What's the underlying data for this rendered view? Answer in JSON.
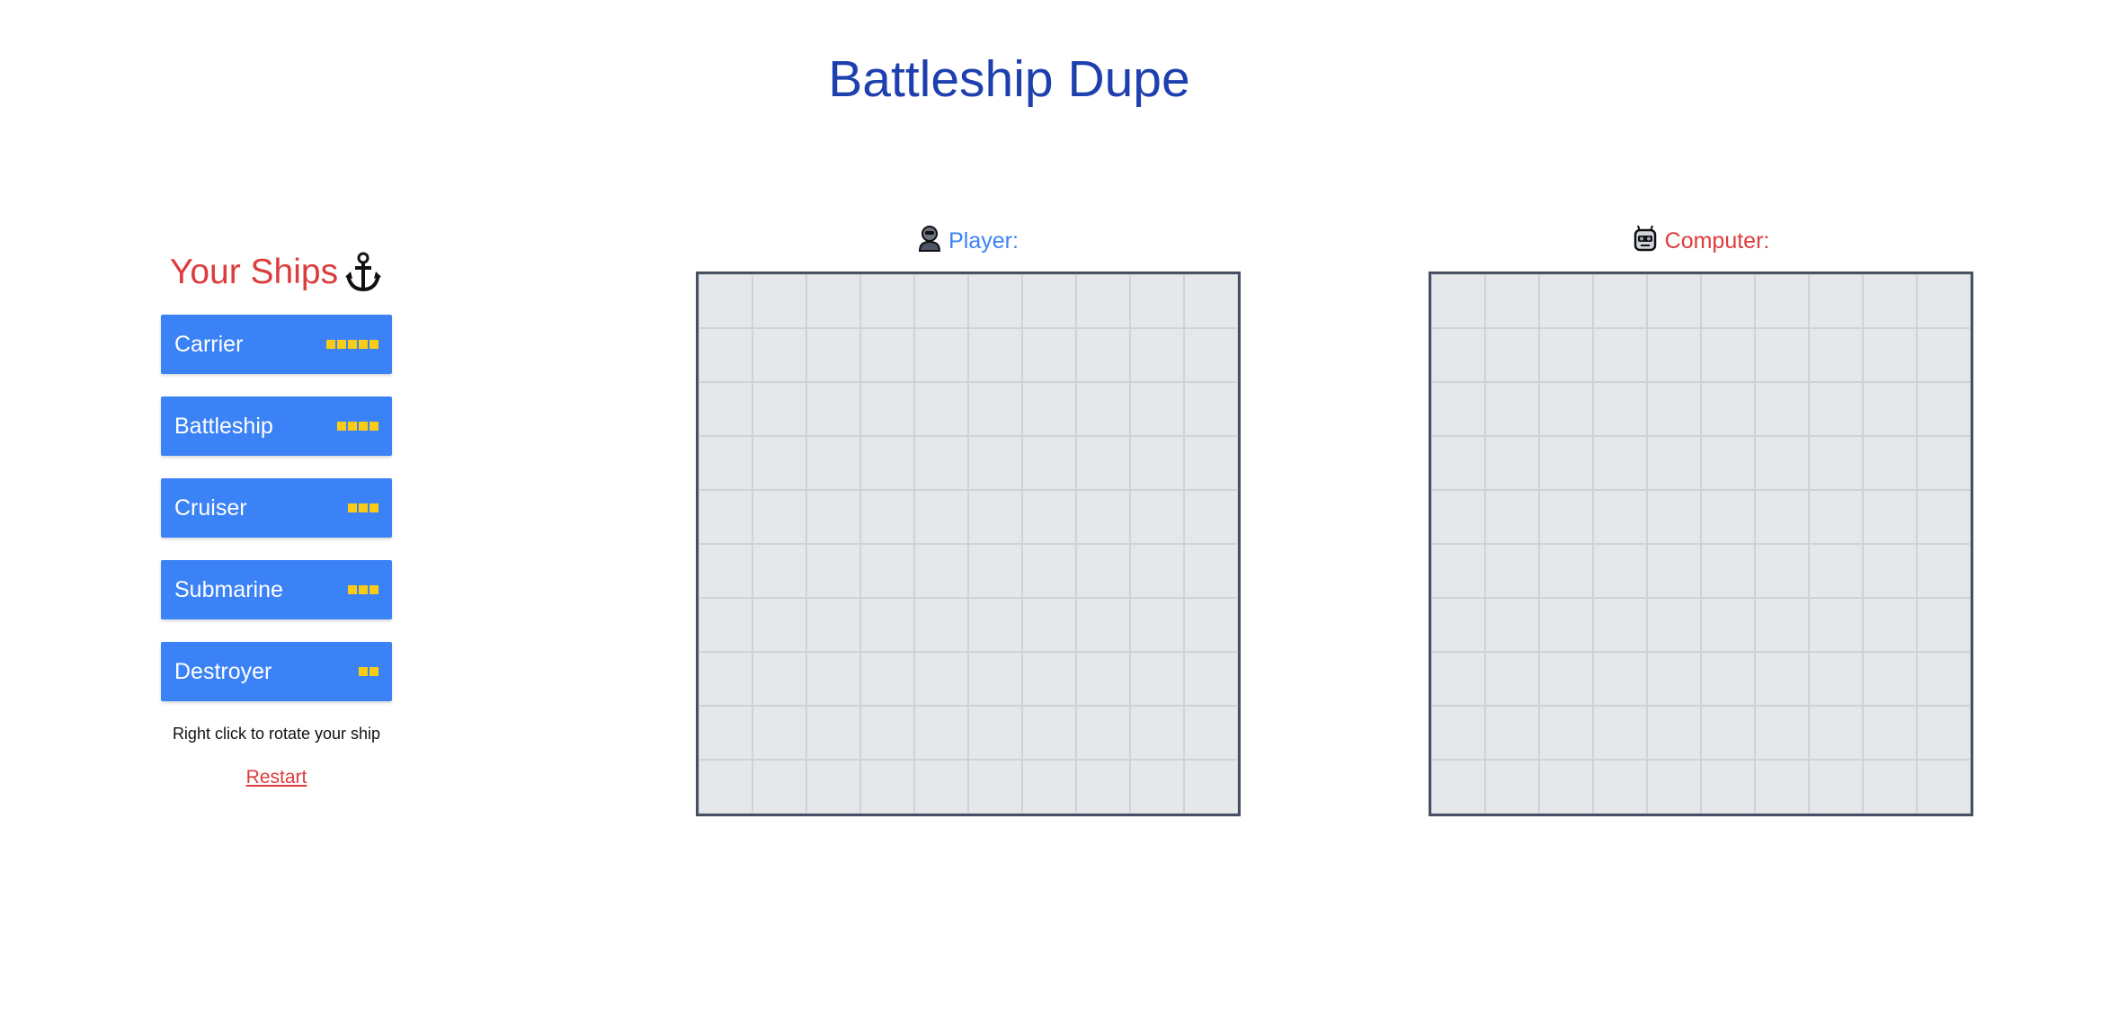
{
  "page": {
    "title": "Battleship Dupe"
  },
  "ships_panel": {
    "heading": "Your Ships",
    "ships": [
      {
        "name": "Carrier",
        "size": 5
      },
      {
        "name": "Battleship",
        "size": 4
      },
      {
        "name": "Cruiser",
        "size": 3
      },
      {
        "name": "Submarine",
        "size": 3
      },
      {
        "name": "Destroyer",
        "size": 2
      }
    ],
    "hint": "Right click to rotate your ship",
    "restart_label": "Restart"
  },
  "boards": {
    "player": {
      "label": "Player:",
      "color": "#3b82f6",
      "rows": 10,
      "cols": 10
    },
    "computer": {
      "label": "Computer:",
      "color": "#dc3c3c",
      "rows": 10,
      "cols": 10
    }
  },
  "colors": {
    "title": "#1e40af",
    "ship_button": "#3b82f6",
    "ship_cell": "#facc15",
    "board_bg": "#e5e7eb",
    "board_border": "#475063"
  }
}
